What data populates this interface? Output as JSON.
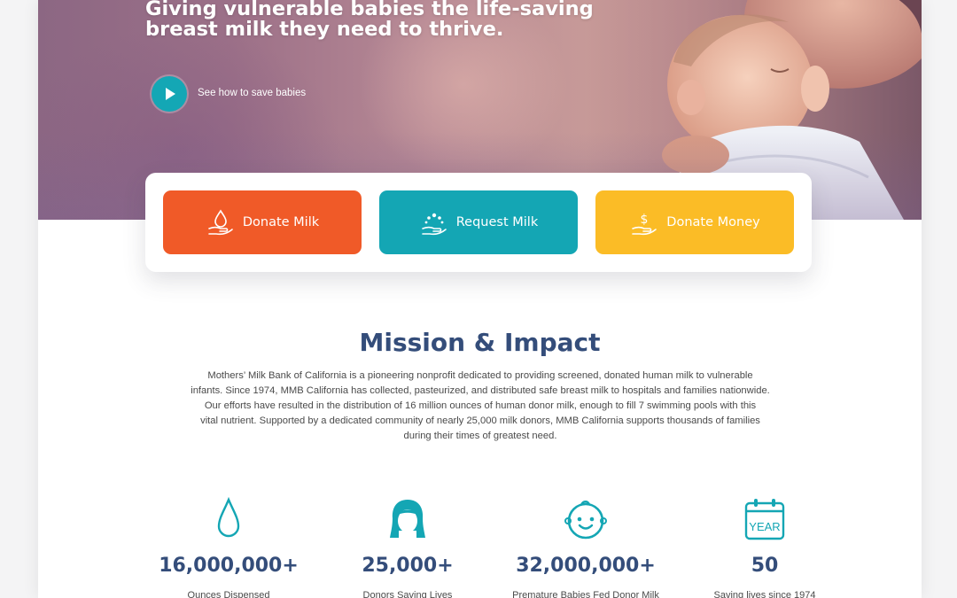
{
  "hero": {
    "title_line1": "Giving vulnerable babies the life-saving",
    "title_line2": "breast milk they need to thrive.",
    "video_link": "See how to save babies"
  },
  "actions": [
    {
      "label": "Donate Milk",
      "color": "#f05a28",
      "icon": "hand-milk-drop-icon"
    },
    {
      "label": "Request Milk",
      "color": "#14a6b4",
      "icon": "hand-splash-icon"
    },
    {
      "label": "Donate Money",
      "color": "#fbbc26",
      "icon": "hand-dollar-icon"
    }
  ],
  "mission": {
    "title": "Mission & Impact",
    "lines": [
      "Mothers’ Milk Bank of California is a pioneering nonprofit dedicated to providing screened, donated human milk to vulnerable",
      "infants. Since 1974, MMB California has collected, pasteurized, and distributed safe breast milk to hospitals and families nationwide.",
      "Our efforts have resulted in the distribution of 16 million ounces of human donor milk, enough to fill 7 swimming pools with this",
      "vital nutrient. Supported by a dedicated community of nearly 25,000 milk donors, MMB California supports thousands of families",
      "during their times of greatest need."
    ]
  },
  "stats": [
    {
      "value": "16,000,000+",
      "label": "Ounces Dispensed",
      "icon": "milk-drop-icon"
    },
    {
      "value": "25,000+",
      "label": "Donors Saving Lives",
      "icon": "woman-icon"
    },
    {
      "value": "32,000,000+",
      "label": "Premature Babies Fed Donor Milk",
      "icon": "baby-face-icon"
    },
    {
      "value": "50",
      "label": "Saving lives since 1974",
      "icon": "year-calendar-icon",
      "icon_text": "YEAR"
    }
  ],
  "colors": {
    "brand_navy": "#344d7a",
    "teal": "#14a6b4",
    "orange": "#f05a28",
    "yellow": "#fbbc26"
  }
}
